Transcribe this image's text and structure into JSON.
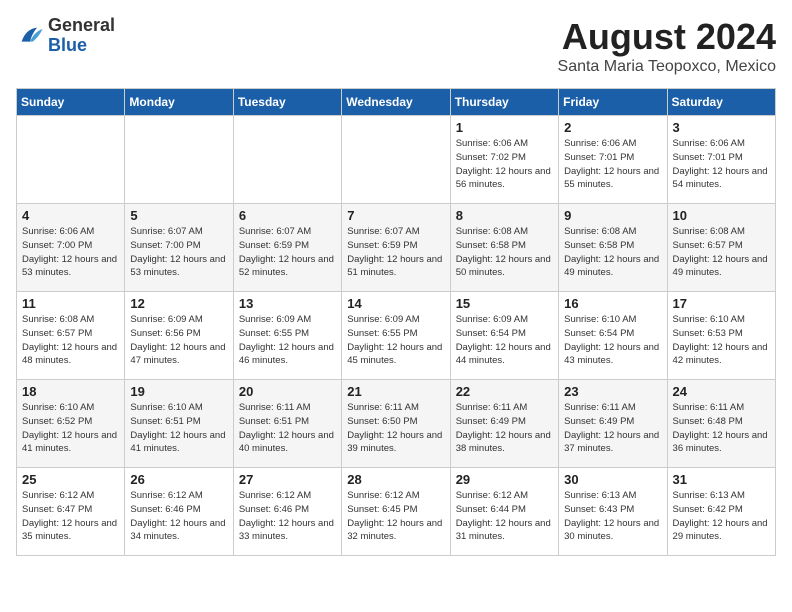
{
  "logo": {
    "general": "General",
    "blue": "Blue"
  },
  "title": "August 2024",
  "location": "Santa Maria Teopoxco, Mexico",
  "days_of_week": [
    "Sunday",
    "Monday",
    "Tuesday",
    "Wednesday",
    "Thursday",
    "Friday",
    "Saturday"
  ],
  "weeks": [
    [
      {
        "day": "",
        "info": ""
      },
      {
        "day": "",
        "info": ""
      },
      {
        "day": "",
        "info": ""
      },
      {
        "day": "",
        "info": ""
      },
      {
        "day": "1",
        "info": "Sunrise: 6:06 AM\nSunset: 7:02 PM\nDaylight: 12 hours\nand 56 minutes."
      },
      {
        "day": "2",
        "info": "Sunrise: 6:06 AM\nSunset: 7:01 PM\nDaylight: 12 hours\nand 55 minutes."
      },
      {
        "day": "3",
        "info": "Sunrise: 6:06 AM\nSunset: 7:01 PM\nDaylight: 12 hours\nand 54 minutes."
      }
    ],
    [
      {
        "day": "4",
        "info": "Sunrise: 6:06 AM\nSunset: 7:00 PM\nDaylight: 12 hours\nand 53 minutes."
      },
      {
        "day": "5",
        "info": "Sunrise: 6:07 AM\nSunset: 7:00 PM\nDaylight: 12 hours\nand 53 minutes."
      },
      {
        "day": "6",
        "info": "Sunrise: 6:07 AM\nSunset: 6:59 PM\nDaylight: 12 hours\nand 52 minutes."
      },
      {
        "day": "7",
        "info": "Sunrise: 6:07 AM\nSunset: 6:59 PM\nDaylight: 12 hours\nand 51 minutes."
      },
      {
        "day": "8",
        "info": "Sunrise: 6:08 AM\nSunset: 6:58 PM\nDaylight: 12 hours\nand 50 minutes."
      },
      {
        "day": "9",
        "info": "Sunrise: 6:08 AM\nSunset: 6:58 PM\nDaylight: 12 hours\nand 49 minutes."
      },
      {
        "day": "10",
        "info": "Sunrise: 6:08 AM\nSunset: 6:57 PM\nDaylight: 12 hours\nand 49 minutes."
      }
    ],
    [
      {
        "day": "11",
        "info": "Sunrise: 6:08 AM\nSunset: 6:57 PM\nDaylight: 12 hours\nand 48 minutes."
      },
      {
        "day": "12",
        "info": "Sunrise: 6:09 AM\nSunset: 6:56 PM\nDaylight: 12 hours\nand 47 minutes."
      },
      {
        "day": "13",
        "info": "Sunrise: 6:09 AM\nSunset: 6:55 PM\nDaylight: 12 hours\nand 46 minutes."
      },
      {
        "day": "14",
        "info": "Sunrise: 6:09 AM\nSunset: 6:55 PM\nDaylight: 12 hours\nand 45 minutes."
      },
      {
        "day": "15",
        "info": "Sunrise: 6:09 AM\nSunset: 6:54 PM\nDaylight: 12 hours\nand 44 minutes."
      },
      {
        "day": "16",
        "info": "Sunrise: 6:10 AM\nSunset: 6:54 PM\nDaylight: 12 hours\nand 43 minutes."
      },
      {
        "day": "17",
        "info": "Sunrise: 6:10 AM\nSunset: 6:53 PM\nDaylight: 12 hours\nand 42 minutes."
      }
    ],
    [
      {
        "day": "18",
        "info": "Sunrise: 6:10 AM\nSunset: 6:52 PM\nDaylight: 12 hours\nand 41 minutes."
      },
      {
        "day": "19",
        "info": "Sunrise: 6:10 AM\nSunset: 6:51 PM\nDaylight: 12 hours\nand 41 minutes."
      },
      {
        "day": "20",
        "info": "Sunrise: 6:11 AM\nSunset: 6:51 PM\nDaylight: 12 hours\nand 40 minutes."
      },
      {
        "day": "21",
        "info": "Sunrise: 6:11 AM\nSunset: 6:50 PM\nDaylight: 12 hours\nand 39 minutes."
      },
      {
        "day": "22",
        "info": "Sunrise: 6:11 AM\nSunset: 6:49 PM\nDaylight: 12 hours\nand 38 minutes."
      },
      {
        "day": "23",
        "info": "Sunrise: 6:11 AM\nSunset: 6:49 PM\nDaylight: 12 hours\nand 37 minutes."
      },
      {
        "day": "24",
        "info": "Sunrise: 6:11 AM\nSunset: 6:48 PM\nDaylight: 12 hours\nand 36 minutes."
      }
    ],
    [
      {
        "day": "25",
        "info": "Sunrise: 6:12 AM\nSunset: 6:47 PM\nDaylight: 12 hours\nand 35 minutes."
      },
      {
        "day": "26",
        "info": "Sunrise: 6:12 AM\nSunset: 6:46 PM\nDaylight: 12 hours\nand 34 minutes."
      },
      {
        "day": "27",
        "info": "Sunrise: 6:12 AM\nSunset: 6:46 PM\nDaylight: 12 hours\nand 33 minutes."
      },
      {
        "day": "28",
        "info": "Sunrise: 6:12 AM\nSunset: 6:45 PM\nDaylight: 12 hours\nand 32 minutes."
      },
      {
        "day": "29",
        "info": "Sunrise: 6:12 AM\nSunset: 6:44 PM\nDaylight: 12 hours\nand 31 minutes."
      },
      {
        "day": "30",
        "info": "Sunrise: 6:13 AM\nSunset: 6:43 PM\nDaylight: 12 hours\nand 30 minutes."
      },
      {
        "day": "31",
        "info": "Sunrise: 6:13 AM\nSunset: 6:42 PM\nDaylight: 12 hours\nand 29 minutes."
      }
    ]
  ]
}
